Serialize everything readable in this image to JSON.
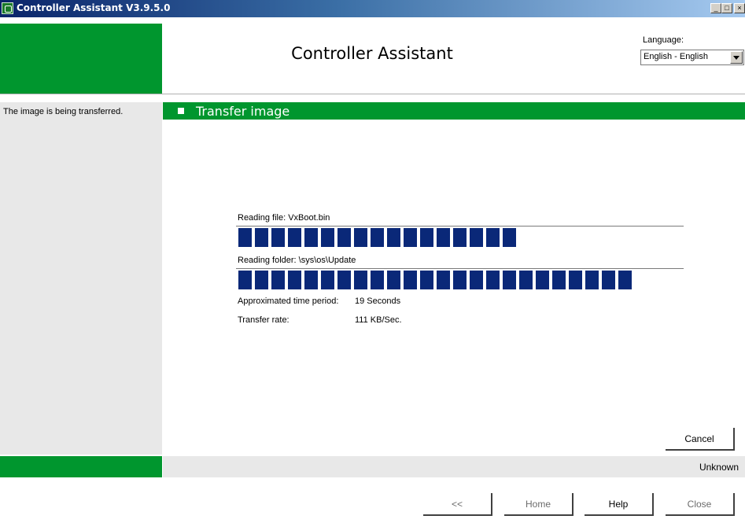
{
  "window": {
    "title": "Controller Assistant V3.9.5.0",
    "controls": [
      "minimize-icon",
      "maximize-icon",
      "close-icon"
    ]
  },
  "header": {
    "app_title": "Controller Assistant",
    "language_label": "Language:",
    "language_value": "English - English"
  },
  "section": {
    "title": "Transfer image"
  },
  "side_panel": {
    "message": "The image is being transferred."
  },
  "progress": {
    "file_label": "Reading file: VxBoot.bin",
    "file_blocks": 17,
    "folder_label": "Reading folder: \\sys\\os\\Update",
    "folder_blocks": 24,
    "time_label": "Approximated time period:",
    "time_value": "19 Seconds",
    "rate_label": "Transfer rate:",
    "rate_value": "111 KB/Sec."
  },
  "actions": {
    "cancel_label": "Cancel"
  },
  "status": {
    "text": "Unknown"
  },
  "nav": {
    "back_label": "<<",
    "home_label": "Home",
    "help_label": "Help",
    "close_label": "Close"
  },
  "colors": {
    "brand_green": "#00962e",
    "progress_blue": "#0a2878",
    "titlebar_blue": "#0a246a"
  }
}
